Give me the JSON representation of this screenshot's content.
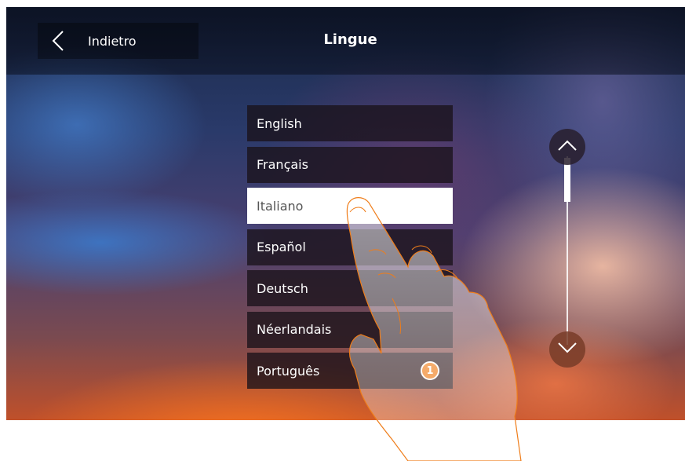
{
  "header": {
    "back_label": "Indietro",
    "title": "Lingue"
  },
  "languages": [
    {
      "label": "English",
      "selected": false
    },
    {
      "label": "Français",
      "selected": false
    },
    {
      "label": "Italiano",
      "selected": true
    },
    {
      "label": "Español",
      "selected": false
    },
    {
      "label": "Deutsch",
      "selected": false
    },
    {
      "label": "Néerlandais",
      "selected": false
    },
    {
      "label": "Português",
      "selected": false
    }
  ],
  "callout": {
    "number": "1",
    "color": "#ef7d1a"
  },
  "icons": {
    "back": "chevron-left-icon",
    "scroll_up": "chevron-up-icon",
    "scroll_down": "chevron-down-icon"
  }
}
